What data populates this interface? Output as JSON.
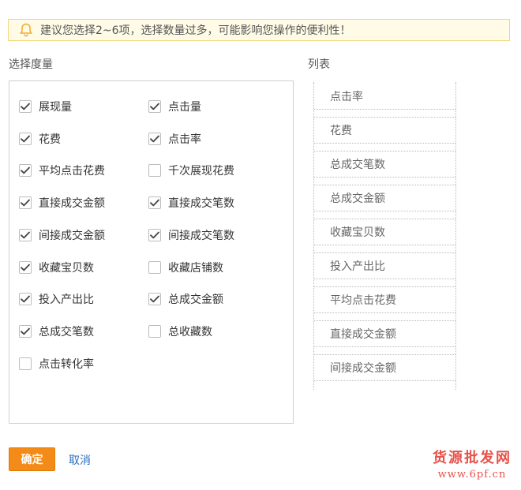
{
  "notice": {
    "text": "建议您选择2~6项，选择数量过多，可能影响您操作的便利性！"
  },
  "metrics_section": {
    "title": "选择度量",
    "items": [
      {
        "label": "展现量",
        "checked": true
      },
      {
        "label": "点击量",
        "checked": true
      },
      {
        "label": "花费",
        "checked": true
      },
      {
        "label": "点击率",
        "checked": true
      },
      {
        "label": "平均点击花费",
        "checked": true
      },
      {
        "label": "千次展现花费",
        "checked": false
      },
      {
        "label": "直接成交金额",
        "checked": true
      },
      {
        "label": "直接成交笔数",
        "checked": true
      },
      {
        "label": "间接成交金额",
        "checked": true
      },
      {
        "label": "间接成交笔数",
        "checked": true
      },
      {
        "label": "收藏宝贝数",
        "checked": true
      },
      {
        "label": "收藏店铺数",
        "checked": false
      },
      {
        "label": "投入产出比",
        "checked": true
      },
      {
        "label": "总成交金额",
        "checked": true
      },
      {
        "label": "总成交笔数",
        "checked": true
      },
      {
        "label": "总收藏数",
        "checked": false
      },
      {
        "label": "点击转化率",
        "checked": false
      }
    ]
  },
  "list_section": {
    "title": "列表",
    "items": [
      "点击率",
      "花费",
      "总成交笔数",
      "总成交金额",
      "收藏宝贝数",
      "投入产出比",
      "平均点击花费",
      "直接成交金额",
      "间接成交金额"
    ]
  },
  "actions": {
    "ok_label": "确定",
    "cancel_label": "取消"
  },
  "watermark": {
    "line1": "货源批发网",
    "line2": "www.6pf.cn"
  },
  "colors": {
    "accent": "#f48a17",
    "link": "#2a6ebf",
    "notice_bg": "#fffbe6",
    "notice_border": "#f1d87b",
    "watermark": "#e8514a"
  }
}
